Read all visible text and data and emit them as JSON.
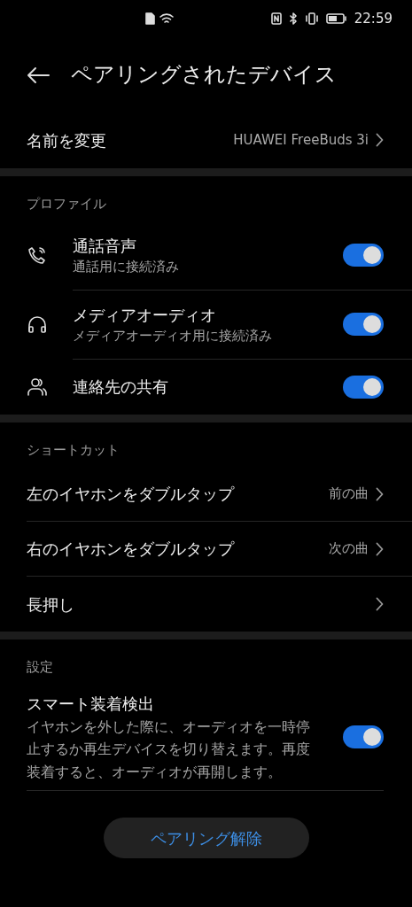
{
  "status_bar": {
    "time": "22:59"
  },
  "header": {
    "title": "ペアリングされたデバイス"
  },
  "rename": {
    "label": "名前を変更",
    "value": "HUAWEI FreeBuds 3i"
  },
  "sections": [
    {
      "title": "プロファイル",
      "items": [
        {
          "kind": "toggle",
          "title": "通話音声",
          "subtitle": "通話用に接続済み",
          "on": true
        },
        {
          "kind": "toggle",
          "title": "メディアオーディオ",
          "subtitle": "メディアオーディオ用に接続済み",
          "on": true
        },
        {
          "kind": "toggle",
          "title": "連絡先の共有",
          "on": true
        }
      ]
    },
    {
      "title": "ショートカット",
      "items": [
        {
          "kind": "link",
          "title": "左のイヤホンをダブルタップ",
          "value": "前の曲"
        },
        {
          "kind": "link",
          "title": "右のイヤホンをダブルタップ",
          "value": "次の曲"
        },
        {
          "kind": "link",
          "title": "長押し"
        }
      ]
    },
    {
      "title": "設定",
      "items": [
        {
          "kind": "toggle",
          "title": "スマート装着検出",
          "subtitle": "イヤホンを外した際に、オーディオを一時停止するか再生デバイスを切り替えます。再度装着すると、オーディオが再開します。",
          "on": true
        }
      ]
    }
  ],
  "unpair_button": "ペアリング解除"
}
